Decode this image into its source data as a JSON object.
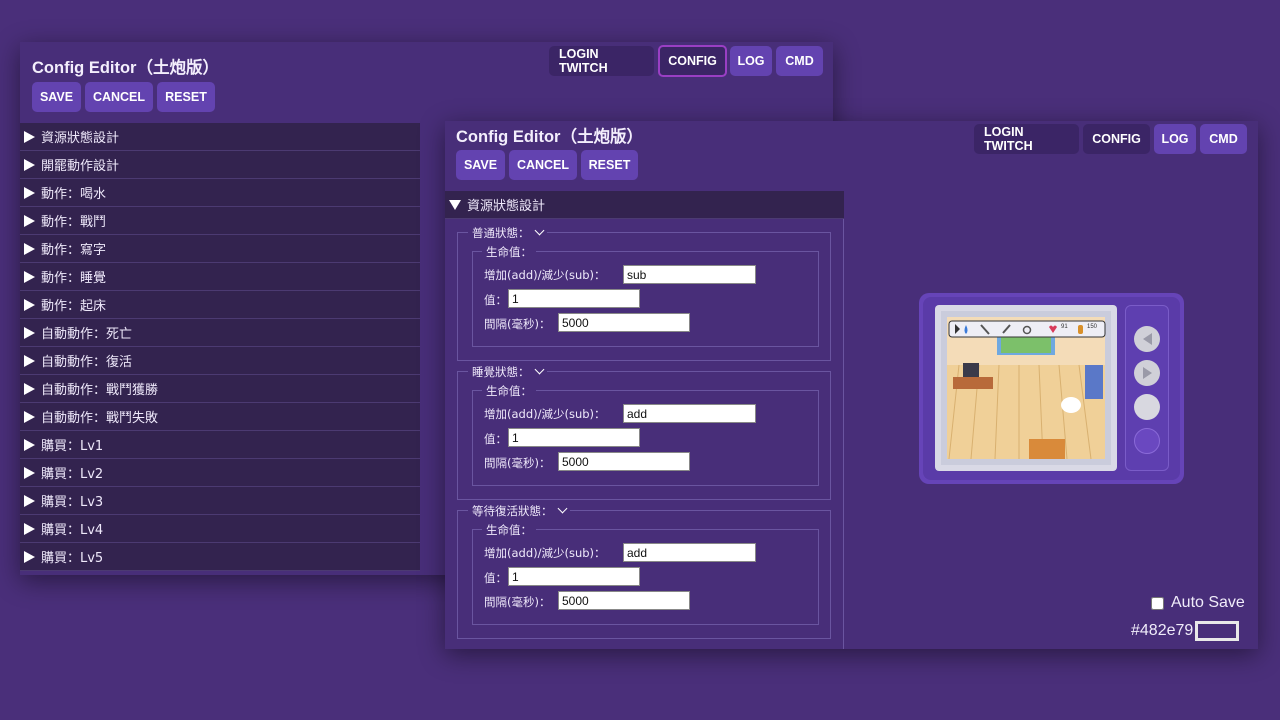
{
  "back_window": {
    "title": "Config Editor（土炮版）",
    "nav": {
      "login": "LOGIN TWITCH",
      "config": "CONFIG",
      "log": "LOG",
      "cmd": "CMD"
    },
    "actions": {
      "save": "SAVE",
      "cancel": "CANCEL",
      "reset": "RESET"
    },
    "sections": [
      "資源狀態設計",
      "開罷動作設計",
      "動作：喝水",
      "動作：戰鬥",
      "動作：寫字",
      "動作：睡覺",
      "動作：起床",
      "自動動作：死亡",
      "自動動作：復活",
      "自動動作：戰鬥獲勝",
      "自動動作：戰鬥失敗",
      "購買：Lv1",
      "購買：Lv2",
      "購買：Lv3",
      "購買：Lv4",
      "購買：Lv5"
    ]
  },
  "front_window": {
    "title": "Config Editor（土炮版）",
    "nav": {
      "login": "LOGIN TWITCH",
      "config": "CONFIG",
      "log": "LOG",
      "cmd": "CMD"
    },
    "actions": {
      "save": "SAVE",
      "cancel": "CANCEL",
      "reset": "RESET"
    },
    "expanded_section": "資源狀態設計",
    "states": [
      {
        "name": "普通狀態：",
        "group": "生命值：",
        "op_label": "增加(add)/減少(sub)：",
        "op": "sub",
        "value_label": "值：",
        "value": "1",
        "interval_label": "間隔(毫秒)：",
        "interval": "5000"
      },
      {
        "name": "睡覺狀態：",
        "group": "生命值：",
        "op_label": "增加(add)/減少(sub)：",
        "op": "add",
        "value_label": "值：",
        "value": "1",
        "interval_label": "間隔(毫秒)：",
        "interval": "5000"
      },
      {
        "name": "等待復活狀態：",
        "group": "生命值：",
        "op_label": "增加(add)/減少(sub)：",
        "op": "add",
        "value_label": "值：",
        "value": "1",
        "interval_label": "間隔(毫秒)：",
        "interval": "5000"
      }
    ],
    "hud": {
      "heart_count": "91",
      "coin_count": "150"
    },
    "auto_save_label": "Auto Save",
    "auto_save_checked": false,
    "bg_color_label": "#482e79",
    "bg_color": "#482e79",
    "colors": {
      "accent": "#6343b0",
      "active_border": "#9a3fc4",
      "panel": "#33234f",
      "background": "#4a2f7a"
    }
  }
}
